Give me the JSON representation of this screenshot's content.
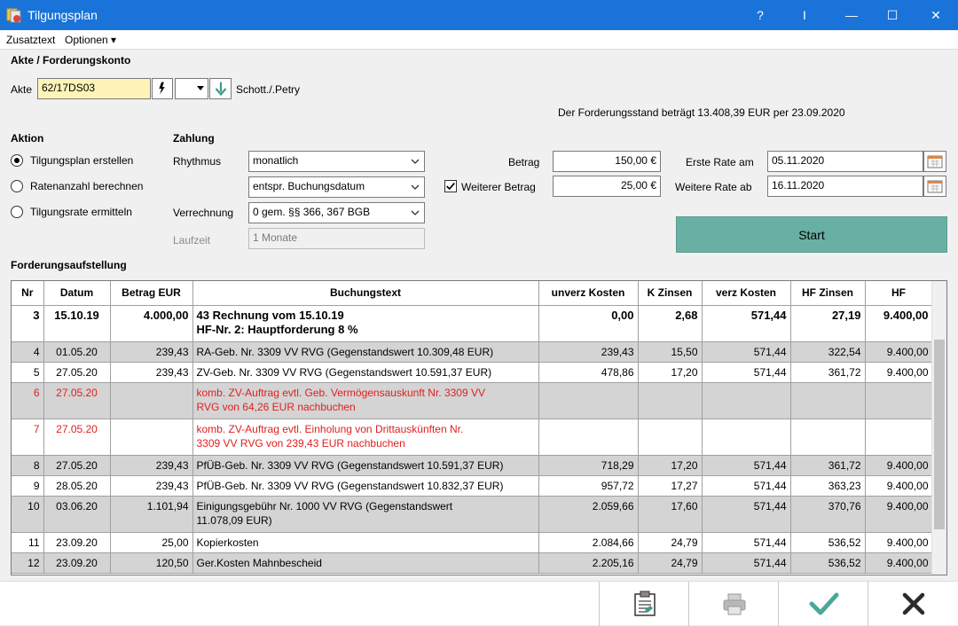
{
  "window": {
    "title": "Tilgungsplan",
    "help": "?",
    "info": "I",
    "minimize": "—",
    "maximize": "☐",
    "close": "✕"
  },
  "menu": {
    "zusatztext": "Zusatztext",
    "optionen": "Optionen ▾"
  },
  "akte_section": {
    "heading": "Akte / Forderungskonto",
    "akte_label": "Akte",
    "akte_value": "62/17DS03",
    "mandant": "Schott./.Petry",
    "stand_text": "Der Forderungsstand beträgt 13.408,39 EUR per 23.09.2020"
  },
  "aktion": {
    "heading": "Aktion",
    "options": [
      "Tilgungsplan erstellen",
      "Ratenanzahl berechnen",
      "Tilgungsrate ermitteln"
    ],
    "selected": 0
  },
  "zahlung": {
    "heading": "Zahlung",
    "rhythmus_label": "Rhythmus",
    "rhythmus_value": "monatlich",
    "buchung_value": "entspr. Buchungsdatum",
    "verrechnung_label": "Verrechnung",
    "verrechnung_value": "0 gem. §§ 366, 367 BGB",
    "laufzeit_label": "Laufzeit",
    "laufzeit_value": "1 Monate",
    "betrag_label": "Betrag",
    "betrag_value": "150,00 €",
    "weiterer_label": "Weiterer Betrag",
    "weiterer_value": "25,00 €",
    "erste_rate_label": "Erste Rate am",
    "erste_rate_value": "05.11.2020",
    "weitere_rate_label": "Weitere Rate ab",
    "weitere_rate_value": "16.11.2020",
    "start_label": "Start"
  },
  "table": {
    "heading": "Forderungsaufstellung",
    "columns": [
      "Nr",
      "Datum",
      "Betrag EUR",
      "Buchungstext",
      "unverz Kosten",
      "K Zinsen",
      "verz Kosten",
      "HF Zinsen",
      "HF"
    ],
    "rows": [
      {
        "nr": "3",
        "datum": "15.10.19",
        "betrag": "4.000,00",
        "text": "43 Rechnung vom 15.10.19",
        "text2": "HF-Nr. 2: Hauptforderung 8 %",
        "unverz": "0,00",
        "kz": "2,68",
        "verz": "571,44",
        "hfz": "27,19",
        "hf": "9.400,00",
        "style": "bold"
      },
      {
        "nr": "4",
        "datum": "01.05.20",
        "betrag": "239,43",
        "text": "RA-Geb. Nr. 3309 VV RVG (Gegenstandswert 10.309,48 EUR)",
        "text2": "",
        "unverz": "239,43",
        "kz": "15,50",
        "verz": "571,44",
        "hfz": "322,54",
        "hf": "9.400,00",
        "style": "gray"
      },
      {
        "nr": "5",
        "datum": "27.05.20",
        "betrag": "239,43",
        "text": "ZV-Geb. Nr. 3309 VV RVG (Gegenstandswert 10.591,37 EUR)",
        "text2": "",
        "unverz": "478,86",
        "kz": "17,20",
        "verz": "571,44",
        "hfz": "361,72",
        "hf": "9.400,00",
        "style": "white"
      },
      {
        "nr": "6",
        "datum": "27.05.20",
        "betrag": "",
        "text": "komb. ZV-Auftrag evtl. Geb. Vermögensauskunft Nr. 3309 VV",
        "text2": "RVG von 64,26 EUR nachbuchen",
        "unverz": "",
        "kz": "",
        "verz": "",
        "hfz": "",
        "hf": "",
        "style": "gray red"
      },
      {
        "nr": "7",
        "datum": "27.05.20",
        "betrag": "",
        "text": "komb. ZV-Auftrag evtl. Einholung von Drittauskünften Nr.",
        "text2": "3309 VV RVG von 239,43 EUR nachbuchen",
        "unverz": "",
        "kz": "",
        "verz": "",
        "hfz": "",
        "hf": "",
        "style": "white red"
      },
      {
        "nr": "8",
        "datum": "27.05.20",
        "betrag": "239,43",
        "text": "PfÜB-Geb. Nr. 3309 VV RVG (Gegenstandswert 10.591,37 EUR)",
        "text2": "",
        "unverz": "718,29",
        "kz": "17,20",
        "verz": "571,44",
        "hfz": "361,72",
        "hf": "9.400,00",
        "style": "gray"
      },
      {
        "nr": "9",
        "datum": "28.05.20",
        "betrag": "239,43",
        "text": "PfÜB-Geb. Nr. 3309 VV RVG (Gegenstandswert 10.832,37 EUR)",
        "text2": "",
        "unverz": "957,72",
        "kz": "17,27",
        "verz": "571,44",
        "hfz": "363,23",
        "hf": "9.400,00",
        "style": "white"
      },
      {
        "nr": "10",
        "datum": "03.06.20",
        "betrag": "1.101,94",
        "text": "Einigungsgebühr Nr. 1000 VV RVG (Gegenstandswert",
        "text2": "11.078,09 EUR)",
        "unverz": "2.059,66",
        "kz": "17,60",
        "verz": "571,44",
        "hfz": "370,76",
        "hf": "9.400,00",
        "style": "gray"
      },
      {
        "nr": "11",
        "datum": "23.09.20",
        "betrag": "25,00",
        "text": "Kopierkosten",
        "text2": "",
        "unverz": "2.084,66",
        "kz": "24,79",
        "verz": "571,44",
        "hfz": "536,52",
        "hf": "9.400,00",
        "style": "white"
      },
      {
        "nr": "12",
        "datum": "23.09.20",
        "betrag": "120,50",
        "text": "Ger.Kosten Mahnbescheid",
        "text2": "",
        "unverz": "2.205,16",
        "kz": "24,79",
        "verz": "571,44",
        "hfz": "536,52",
        "hf": "9.400,00",
        "style": "gray"
      }
    ]
  },
  "colors": {
    "titlebar": "#1a73d9",
    "start": "#68b0a3",
    "checkmark": "#4aa89a",
    "red_text": "#e02020"
  },
  "icons": [
    "app-icon",
    "lightning-icon",
    "dropdown-arrow-icon",
    "down-arrow-icon",
    "calendar-icon",
    "clipboard-icon",
    "printer-icon",
    "checkmark-icon",
    "close-x-icon"
  ]
}
